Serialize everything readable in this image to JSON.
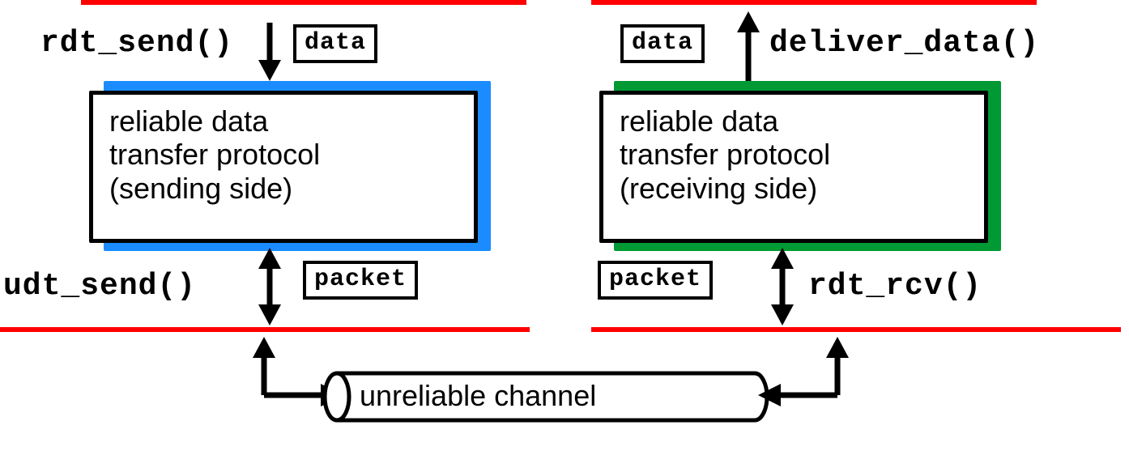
{
  "left": {
    "top_func": "rdt_send()",
    "data_label": "data",
    "box_line1": "reliable data",
    "box_line2": "transfer protocol",
    "box_line3": "(sending side)",
    "packet_label": "packet",
    "bottom_func": "udt_send()"
  },
  "right": {
    "top_func": "deliver_data()",
    "data_label": "data",
    "box_line1": "reliable data",
    "box_line2": "transfer protocol",
    "box_line3": "(receiving side)",
    "packet_label": "packet",
    "bottom_func": "rdt_rcv()"
  },
  "channel_label": "unreliable channel",
  "colors": {
    "left_shadow": "#1a8cff",
    "right_shadow": "#009933",
    "red": "#ff0000"
  }
}
